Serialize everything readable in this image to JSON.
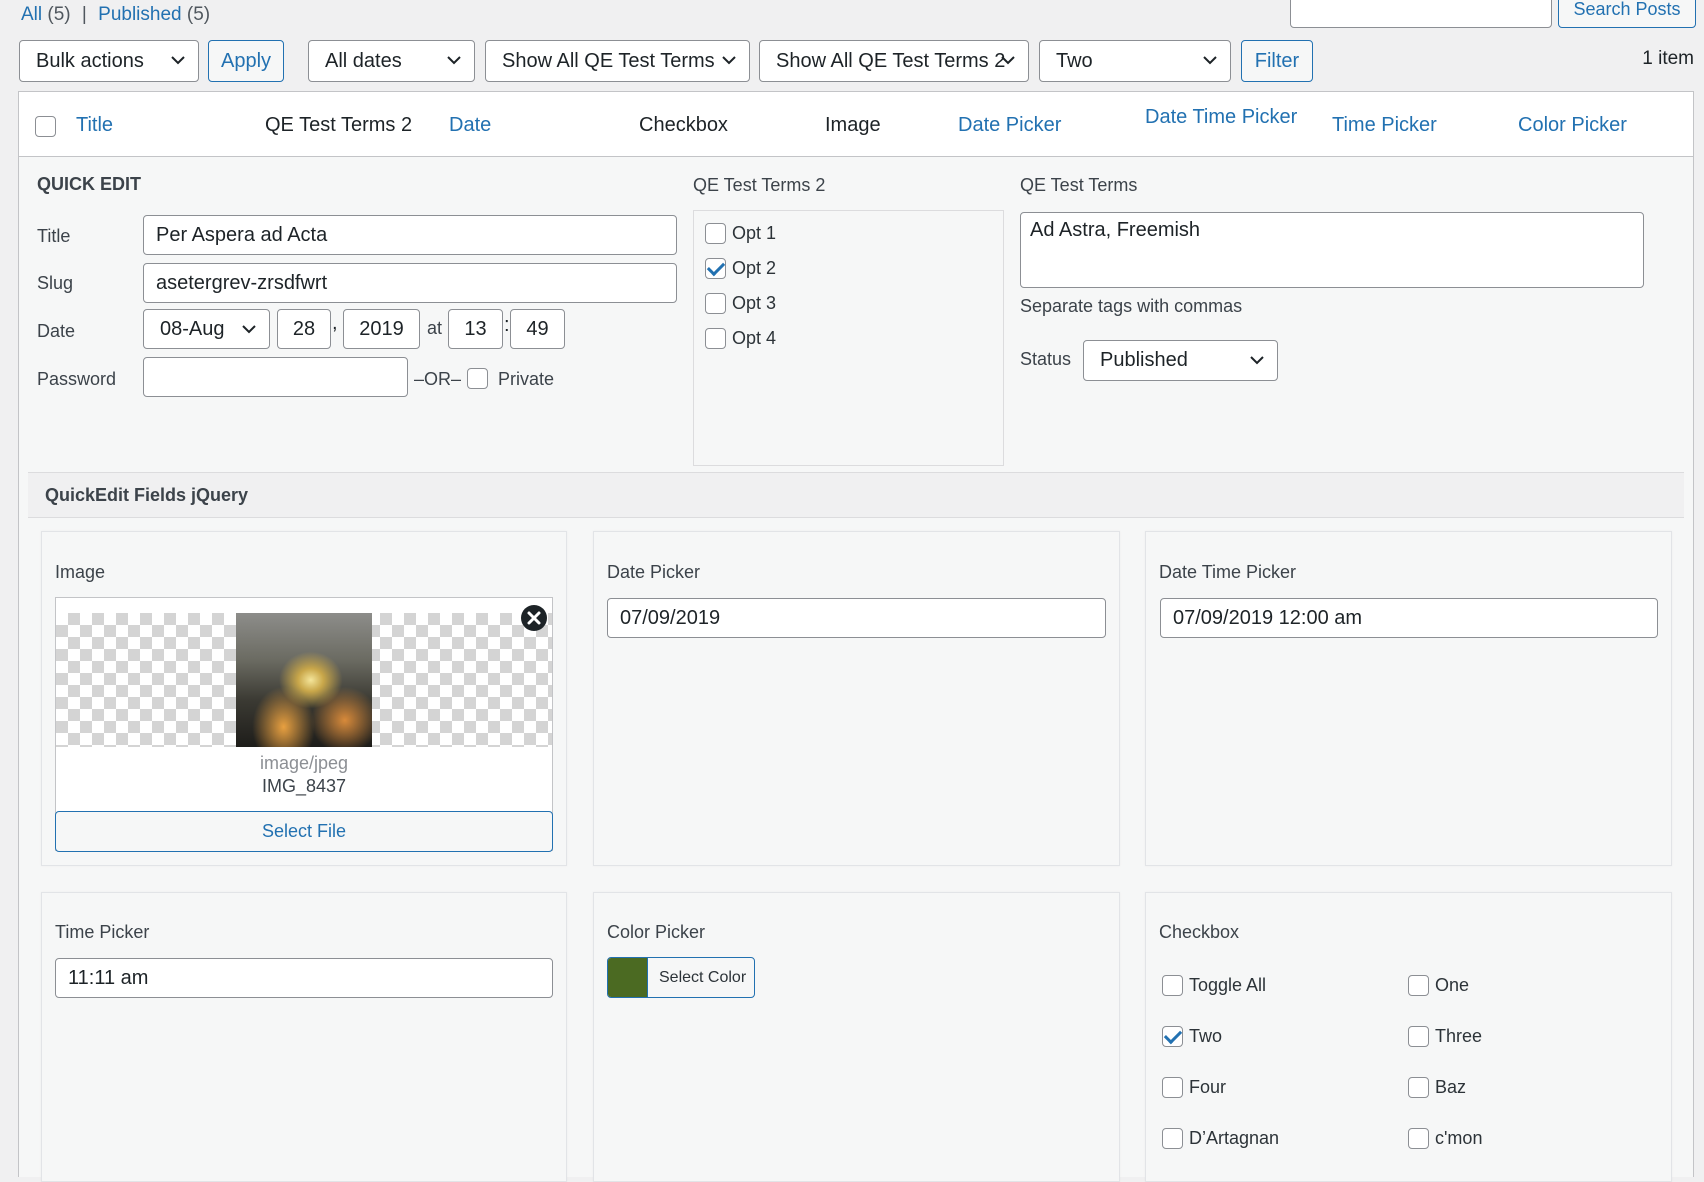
{
  "views": {
    "all_label": "All",
    "all_count": "(5)",
    "sep": "|",
    "published_label": "Published",
    "published_count": "(5)"
  },
  "search": {
    "button_label": "Search Posts",
    "value": ""
  },
  "filters": {
    "bulk_actions": "Bulk actions",
    "apply": "Apply",
    "dates": "All dates",
    "terms1": "Show All QE Test Terms",
    "terms2": "Show All QE Test Terms 2",
    "two": "Two",
    "filter": "Filter",
    "item_count": "1 item"
  },
  "columns": {
    "title": "Title",
    "qe_terms2": "QE Test Terms 2",
    "date": "Date",
    "checkbox": "Checkbox",
    "image": "Image",
    "date_picker": "Date Picker",
    "date_time_picker": "Date Time Picker",
    "time_picker": "Time Picker",
    "color_picker": "Color Picker"
  },
  "quick_edit": {
    "heading": "QUICK EDIT",
    "title_label": "Title",
    "title_value": "Per Aspera ad Acta",
    "slug_label": "Slug",
    "slug_value": "asetergrev-zrsdfwrt",
    "date_label": "Date",
    "month": "08-Aug",
    "day": "28",
    "comma": ",",
    "year": "2019",
    "at": "at",
    "hour": "13",
    "colon": ":",
    "minute": "49",
    "password_label": "Password",
    "password_value": "",
    "or": "–OR–",
    "private_label": "Private",
    "terms2_heading": "QE Test Terms 2",
    "terms2_options": [
      {
        "label": "Opt 1",
        "checked": false
      },
      {
        "label": "Opt 2",
        "checked": true
      },
      {
        "label": "Opt 3",
        "checked": false
      },
      {
        "label": "Opt 4",
        "checked": false
      }
    ],
    "terms_heading": "QE Test Terms",
    "terms_value": "Ad Astra, Freemish",
    "terms_hint": "Separate tags with commas",
    "status_label": "Status",
    "status_value": "Published"
  },
  "fields": {
    "section_title": "QuickEdit Fields jQuery",
    "image_label": "Image",
    "image_mime": "image/jpeg",
    "image_name": "IMG_8437",
    "select_file": "Select File",
    "date_picker_label": "Date Picker",
    "date_picker_value": "07/09/2019",
    "date_time_picker_label": "Date Time Picker",
    "date_time_picker_value": "07/09/2019 12:00 am",
    "time_picker_label": "Time Picker",
    "time_picker_value": "11:11 am",
    "color_picker_label": "Color Picker",
    "color_value": "#4b6a22",
    "select_color": "Select Color",
    "checkbox_label": "Checkbox",
    "checkbox_options": [
      {
        "label": "Toggle All",
        "checked": false
      },
      {
        "label": "One",
        "checked": false
      },
      {
        "label": "Two",
        "checked": true
      },
      {
        "label": "Three",
        "checked": false
      },
      {
        "label": "Four",
        "checked": false
      },
      {
        "label": "Baz",
        "checked": false
      },
      {
        "label": "D’Artagnan",
        "checked": false
      },
      {
        "label": "c'mon",
        "checked": false
      }
    ]
  },
  "colors": {
    "accent": "#2271b1",
    "text": "#1d2327",
    "panel": "#f6f7f7"
  }
}
